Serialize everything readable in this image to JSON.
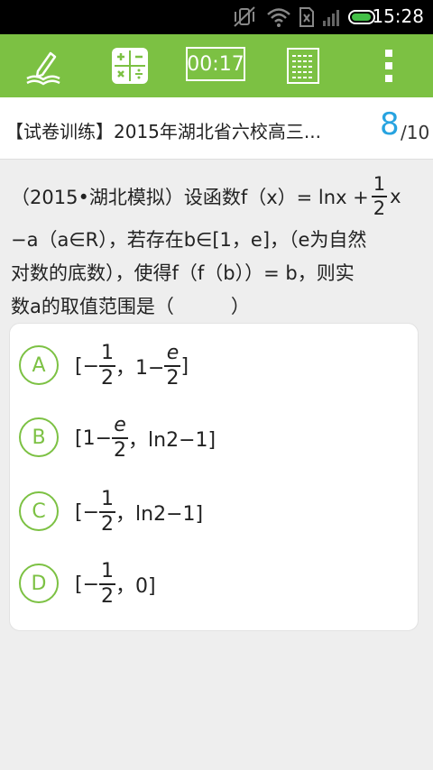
{
  "status_bar": {
    "time": "15:28"
  },
  "toolbar": {
    "icons": [
      "pencil-book-icon",
      "calculator-icon",
      "answer-sheet-icon",
      "more-vertical-icon"
    ],
    "timer": "00:17"
  },
  "header": {
    "title": "【试卷训练】2015年湖北省六校高三...",
    "current": "8",
    "total": "/10"
  },
  "question": {
    "line1_pre": "（2015•湖北模拟）设函数f（x）= lnx +",
    "line1_frac_num": "1",
    "line1_frac_den": "2",
    "line1_post": "x",
    "line2": "−a（a∈R），若存在b∈[1，e]，（e为自然",
    "line3": "对数的底数），使得f（f（b））= b，则实",
    "line4": "数a的取值范围是（　　　）"
  },
  "options": [
    {
      "letter": "A",
      "pre": "[−",
      "frac1_num": "1",
      "frac1_den": "2",
      "mid": "，1−",
      "frac2_num": "e",
      "frac2_den": "2",
      "post": "]"
    },
    {
      "letter": "B",
      "pre": "[1−",
      "frac1_num": "e",
      "frac1_den": "2",
      "post": "，ln2−1]"
    },
    {
      "letter": "C",
      "pre": "[−",
      "frac1_num": "1",
      "frac1_den": "2",
      "post": "，ln2−1]"
    },
    {
      "letter": "D",
      "pre": "[−",
      "frac1_num": "1",
      "frac1_den": "2",
      "post": "，0]"
    }
  ],
  "colors": {
    "accent": "#7cc143",
    "counter": "#27a3e0"
  }
}
